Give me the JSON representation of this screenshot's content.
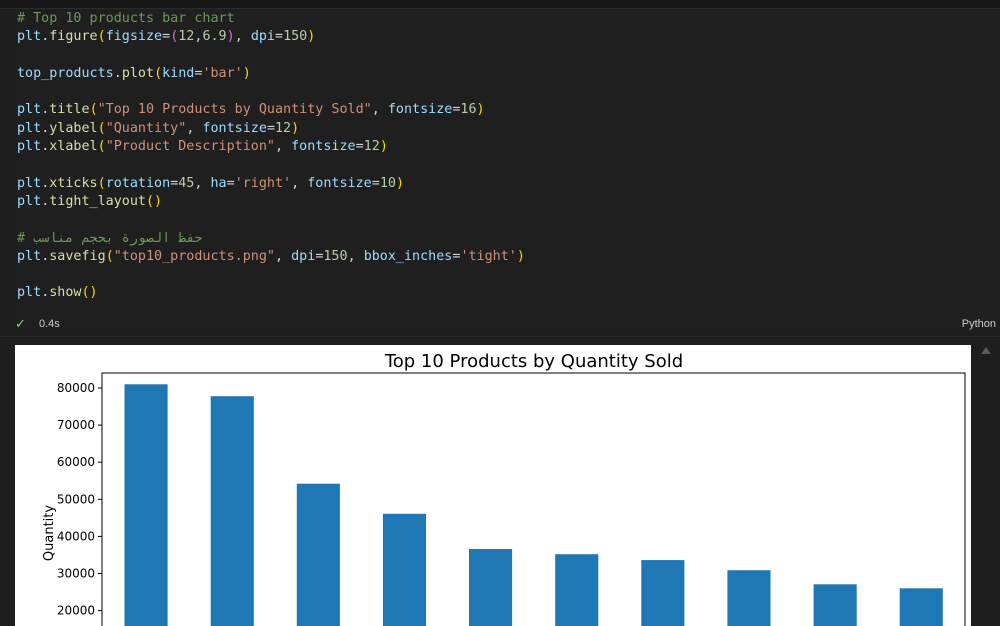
{
  "code": {
    "lines": [
      [
        {
          "t": "# Top 10 products bar chart",
          "c": "comment"
        }
      ],
      [
        {
          "t": "plt",
          "c": "var"
        },
        {
          "t": "."
        },
        {
          "t": "figure",
          "c": "fn"
        },
        {
          "t": "(",
          "c": "paren"
        },
        {
          "t": "figsize",
          "c": "var"
        },
        {
          "t": "="
        },
        {
          "t": "(",
          "c": "paren2"
        },
        {
          "t": "12",
          "c": "num"
        },
        {
          "t": ","
        },
        {
          "t": "6.9",
          "c": "num"
        },
        {
          "t": ")",
          "c": "paren2"
        },
        {
          "t": ", "
        },
        {
          "t": "dpi",
          "c": "var"
        },
        {
          "t": "="
        },
        {
          "t": "150",
          "c": "num"
        },
        {
          "t": ")",
          "c": "paren"
        }
      ],
      [],
      [
        {
          "t": "top_products",
          "c": "var"
        },
        {
          "t": "."
        },
        {
          "t": "plot",
          "c": "fn"
        },
        {
          "t": "(",
          "c": "paren"
        },
        {
          "t": "kind",
          "c": "var"
        },
        {
          "t": "="
        },
        {
          "t": "'bar'",
          "c": "str"
        },
        {
          "t": ")",
          "c": "paren"
        }
      ],
      [],
      [
        {
          "t": "plt",
          "c": "var"
        },
        {
          "t": "."
        },
        {
          "t": "title",
          "c": "fn"
        },
        {
          "t": "(",
          "c": "paren"
        },
        {
          "t": "\"Top 10 Products by Quantity Sold\"",
          "c": "str"
        },
        {
          "t": ", "
        },
        {
          "t": "fontsize",
          "c": "var"
        },
        {
          "t": "="
        },
        {
          "t": "16",
          "c": "num"
        },
        {
          "t": ")",
          "c": "paren"
        }
      ],
      [
        {
          "t": "plt",
          "c": "var"
        },
        {
          "t": "."
        },
        {
          "t": "ylabel",
          "c": "fn"
        },
        {
          "t": "(",
          "c": "paren"
        },
        {
          "t": "\"Quantity\"",
          "c": "str"
        },
        {
          "t": ", "
        },
        {
          "t": "fontsize",
          "c": "var"
        },
        {
          "t": "="
        },
        {
          "t": "12",
          "c": "num"
        },
        {
          "t": ")",
          "c": "paren"
        }
      ],
      [
        {
          "t": "plt",
          "c": "var"
        },
        {
          "t": "."
        },
        {
          "t": "xlabel",
          "c": "fn"
        },
        {
          "t": "(",
          "c": "paren"
        },
        {
          "t": "\"Product Description\"",
          "c": "str"
        },
        {
          "t": ", "
        },
        {
          "t": "fontsize",
          "c": "var"
        },
        {
          "t": "="
        },
        {
          "t": "12",
          "c": "num"
        },
        {
          "t": ")",
          "c": "paren"
        }
      ],
      [],
      [
        {
          "t": "plt",
          "c": "var"
        },
        {
          "t": "."
        },
        {
          "t": "xticks",
          "c": "fn"
        },
        {
          "t": "(",
          "c": "paren"
        },
        {
          "t": "rotation",
          "c": "var"
        },
        {
          "t": "="
        },
        {
          "t": "45",
          "c": "num"
        },
        {
          "t": ", "
        },
        {
          "t": "ha",
          "c": "var"
        },
        {
          "t": "="
        },
        {
          "t": "'right'",
          "c": "str"
        },
        {
          "t": ", "
        },
        {
          "t": "fontsize",
          "c": "var"
        },
        {
          "t": "="
        },
        {
          "t": "10",
          "c": "num"
        },
        {
          "t": ")",
          "c": "paren"
        }
      ],
      [
        {
          "t": "plt",
          "c": "var"
        },
        {
          "t": "."
        },
        {
          "t": "tight_layout",
          "c": "fn"
        },
        {
          "t": "()",
          "c": "paren"
        }
      ],
      [],
      [
        {
          "t": "# حفظ الصورة بحجم مناسب",
          "c": "comment"
        }
      ],
      [
        {
          "t": "plt",
          "c": "var"
        },
        {
          "t": "."
        },
        {
          "t": "savefig",
          "c": "fn"
        },
        {
          "t": "(",
          "c": "paren"
        },
        {
          "t": "\"top10_products.png\"",
          "c": "str"
        },
        {
          "t": ", "
        },
        {
          "t": "dpi",
          "c": "var"
        },
        {
          "t": "="
        },
        {
          "t": "150",
          "c": "num"
        },
        {
          "t": ", "
        },
        {
          "t": "bbox_inches",
          "c": "var"
        },
        {
          "t": "="
        },
        {
          "t": "'tight'",
          "c": "str"
        },
        {
          "t": ")",
          "c": "paren"
        }
      ],
      [],
      [
        {
          "t": "plt",
          "c": "var"
        },
        {
          "t": "."
        },
        {
          "t": "show",
          "c": "fn"
        },
        {
          "t": "()",
          "c": "paren"
        }
      ]
    ]
  },
  "status": {
    "check_icon": "check-icon",
    "exec_time": "0.4s",
    "language": "Python"
  },
  "chart_data": {
    "type": "bar",
    "title": "Top 10 Products by Quantity Sold",
    "xlabel": "",
    "ylabel": "Quantity",
    "values": [
      81000,
      77800,
      54200,
      46100,
      36600,
      35200,
      33600,
      30900,
      27100,
      26000
    ],
    "yticks": [
      20000,
      30000,
      40000,
      50000,
      60000,
      70000,
      80000
    ],
    "ylim": [
      0,
      85000
    ],
    "bar_color": "#1f77b4",
    "grid": false
  }
}
